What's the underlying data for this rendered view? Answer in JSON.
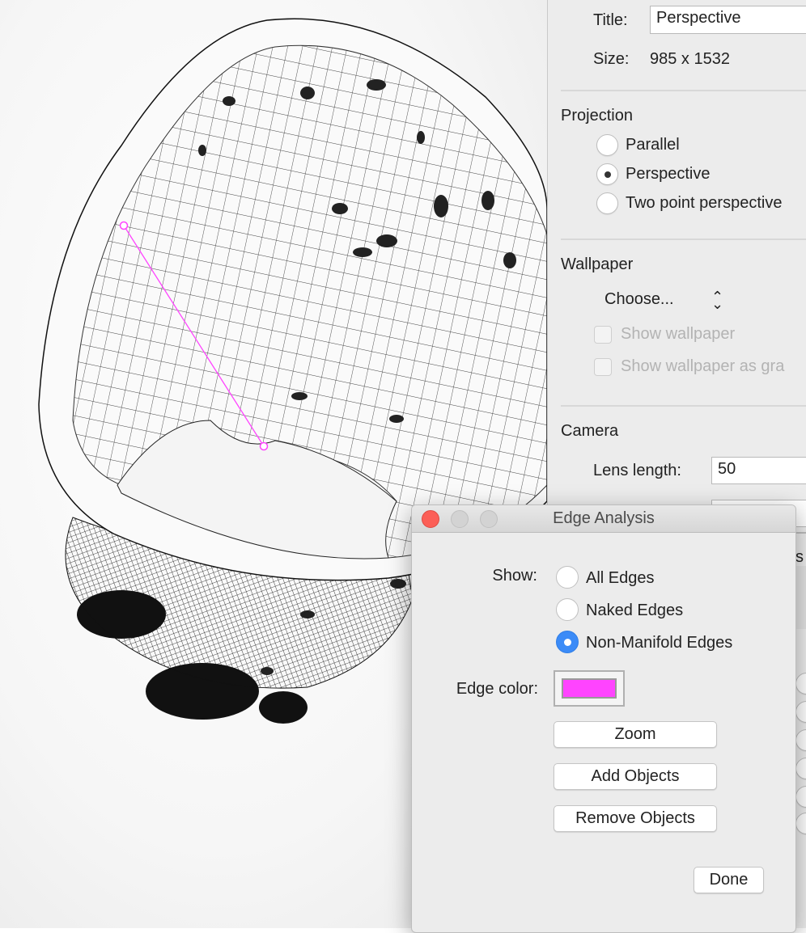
{
  "viewport": {
    "edge_color": "#ff44ff"
  },
  "panel": {
    "title_label": "Title:",
    "title_value": "Perspective",
    "size_label": "Size:",
    "size_value": "985 x 1532",
    "projection": {
      "heading": "Projection",
      "options": [
        "Parallel",
        "Perspective",
        "Two point perspective"
      ],
      "selected": "Perspective"
    },
    "wallpaper": {
      "heading": "Wallpaper",
      "choose": "Choose...",
      "show_wallpaper": "Show wallpaper",
      "show_gray": "Show wallpaper as gra"
    },
    "camera": {
      "heading": "Camera",
      "lens_label": "Lens length:",
      "lens_value": "50"
    },
    "partial_text": "s"
  },
  "dialog": {
    "title": "Edge Analysis",
    "show_label": "Show:",
    "options": [
      "All Edges",
      "Naked Edges",
      "Non-Manifold Edges"
    ],
    "selected": "Non-Manifold Edges",
    "edge_color_label": "Edge color:",
    "edge_color": "#ff44ff",
    "buttons": {
      "zoom": "Zoom",
      "add": "Add Objects",
      "remove": "Remove Objects",
      "done": "Done"
    }
  }
}
